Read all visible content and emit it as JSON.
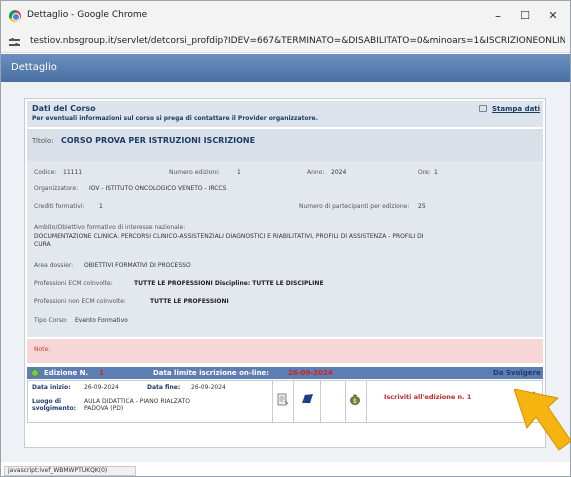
{
  "window": {
    "title": "Dettaglio - Google Chrome",
    "min": "–",
    "max": "☐",
    "close": "✕"
  },
  "address": {
    "url": "testiov.nbsgroup.it/servlet/detcorsi_profdip?IDEV=667&TERMINATO=&DISABILITATO=0&minoars=1&ISCRIZIONEONLINE=S&..."
  },
  "dialog": {
    "title": "Dettaglio"
  },
  "course": {
    "section_title": "Dati del Corso",
    "section_sub": "Per eventuali informazioni sul corso si prega di contattare il Provider organizzatore.",
    "print_label": "Stampa dati",
    "title_label": "Titolo:",
    "title_value": "CORSO PROVA PER ISTRUZIONI ISCRIZIONE",
    "codice_label": "Codice:",
    "codice_value": "11111",
    "num_ed_label": "Numero edizioni:",
    "num_ed_value": "1",
    "anno_label": "Anno:",
    "anno_value": "2024",
    "ore_label": "Ore:",
    "ore_value": "1",
    "org_label": "Organizzatore:",
    "org_value": "IOV - ISTITUTO ONCOLOGICO VENETO - IRCCS",
    "crediti_label": "Crediti formativi:",
    "crediti_value": "1",
    "partecipanti_label": "Numero di partecipanti per edizione:",
    "partecipanti_value": "25",
    "ambito_label": "Ambito/Obiettivo formativo di interesse nazionale:",
    "ambito_value_1": "DOCUMENTAZIONE CLINICA. PERCORSI CLINICO-ASSISTENZIALI DIAGNOSTICI E RIABILITATIVI, PROFILI DI ASSISTENZA - PROFILI DI",
    "ambito_value_2": "CURA",
    "area_label": "Area dossier:",
    "area_value": "OBIETTIVI FORMATIVI DI PROCESSO",
    "prof_ecm_label": "Professioni ECM coinvolte:",
    "prof_ecm_value": "TUTTE LE PROFESSIONI Discipline: TUTTE LE DISCIPLINE",
    "prof_nonecm_label": "Professioni non ECM coinvolte:",
    "prof_nonecm_value": "TUTTE LE PROFESSIONI",
    "tipo_label": "Tipo Corso:",
    "tipo_value": "Evento Formativo",
    "note_label": "Note:"
  },
  "edition": {
    "label": "Edizione N.",
    "number": "1",
    "deadline_label": "Data limite iscrizione on-line:",
    "deadline_value": "26-09-2024",
    "status": "Da Svolgere",
    "start_label": "Data inizio:",
    "start_value": "26-09-2024",
    "end_label": "Data fine:",
    "end_value": "26-09-2024",
    "place_label_1": "Luogo di",
    "place_label_2": "svolgimento:",
    "place_value_1": "AULA DIDATTICA - PIANO RIALZATO",
    "place_value_2": "PADOVA (PD)",
    "enroll_text": "Iscriviti all'edizione n. 1"
  },
  "statusbar": {
    "text": "javascript:ivef_WBMWPTUKQK(0)"
  },
  "colors": {
    "dialog_bar": "#5a7fb5",
    "section_blue": "#1d3c6a",
    "accent_red": "#d21f1f",
    "note_pink": "#f7d6d6",
    "pointer": "#f5b40f"
  }
}
